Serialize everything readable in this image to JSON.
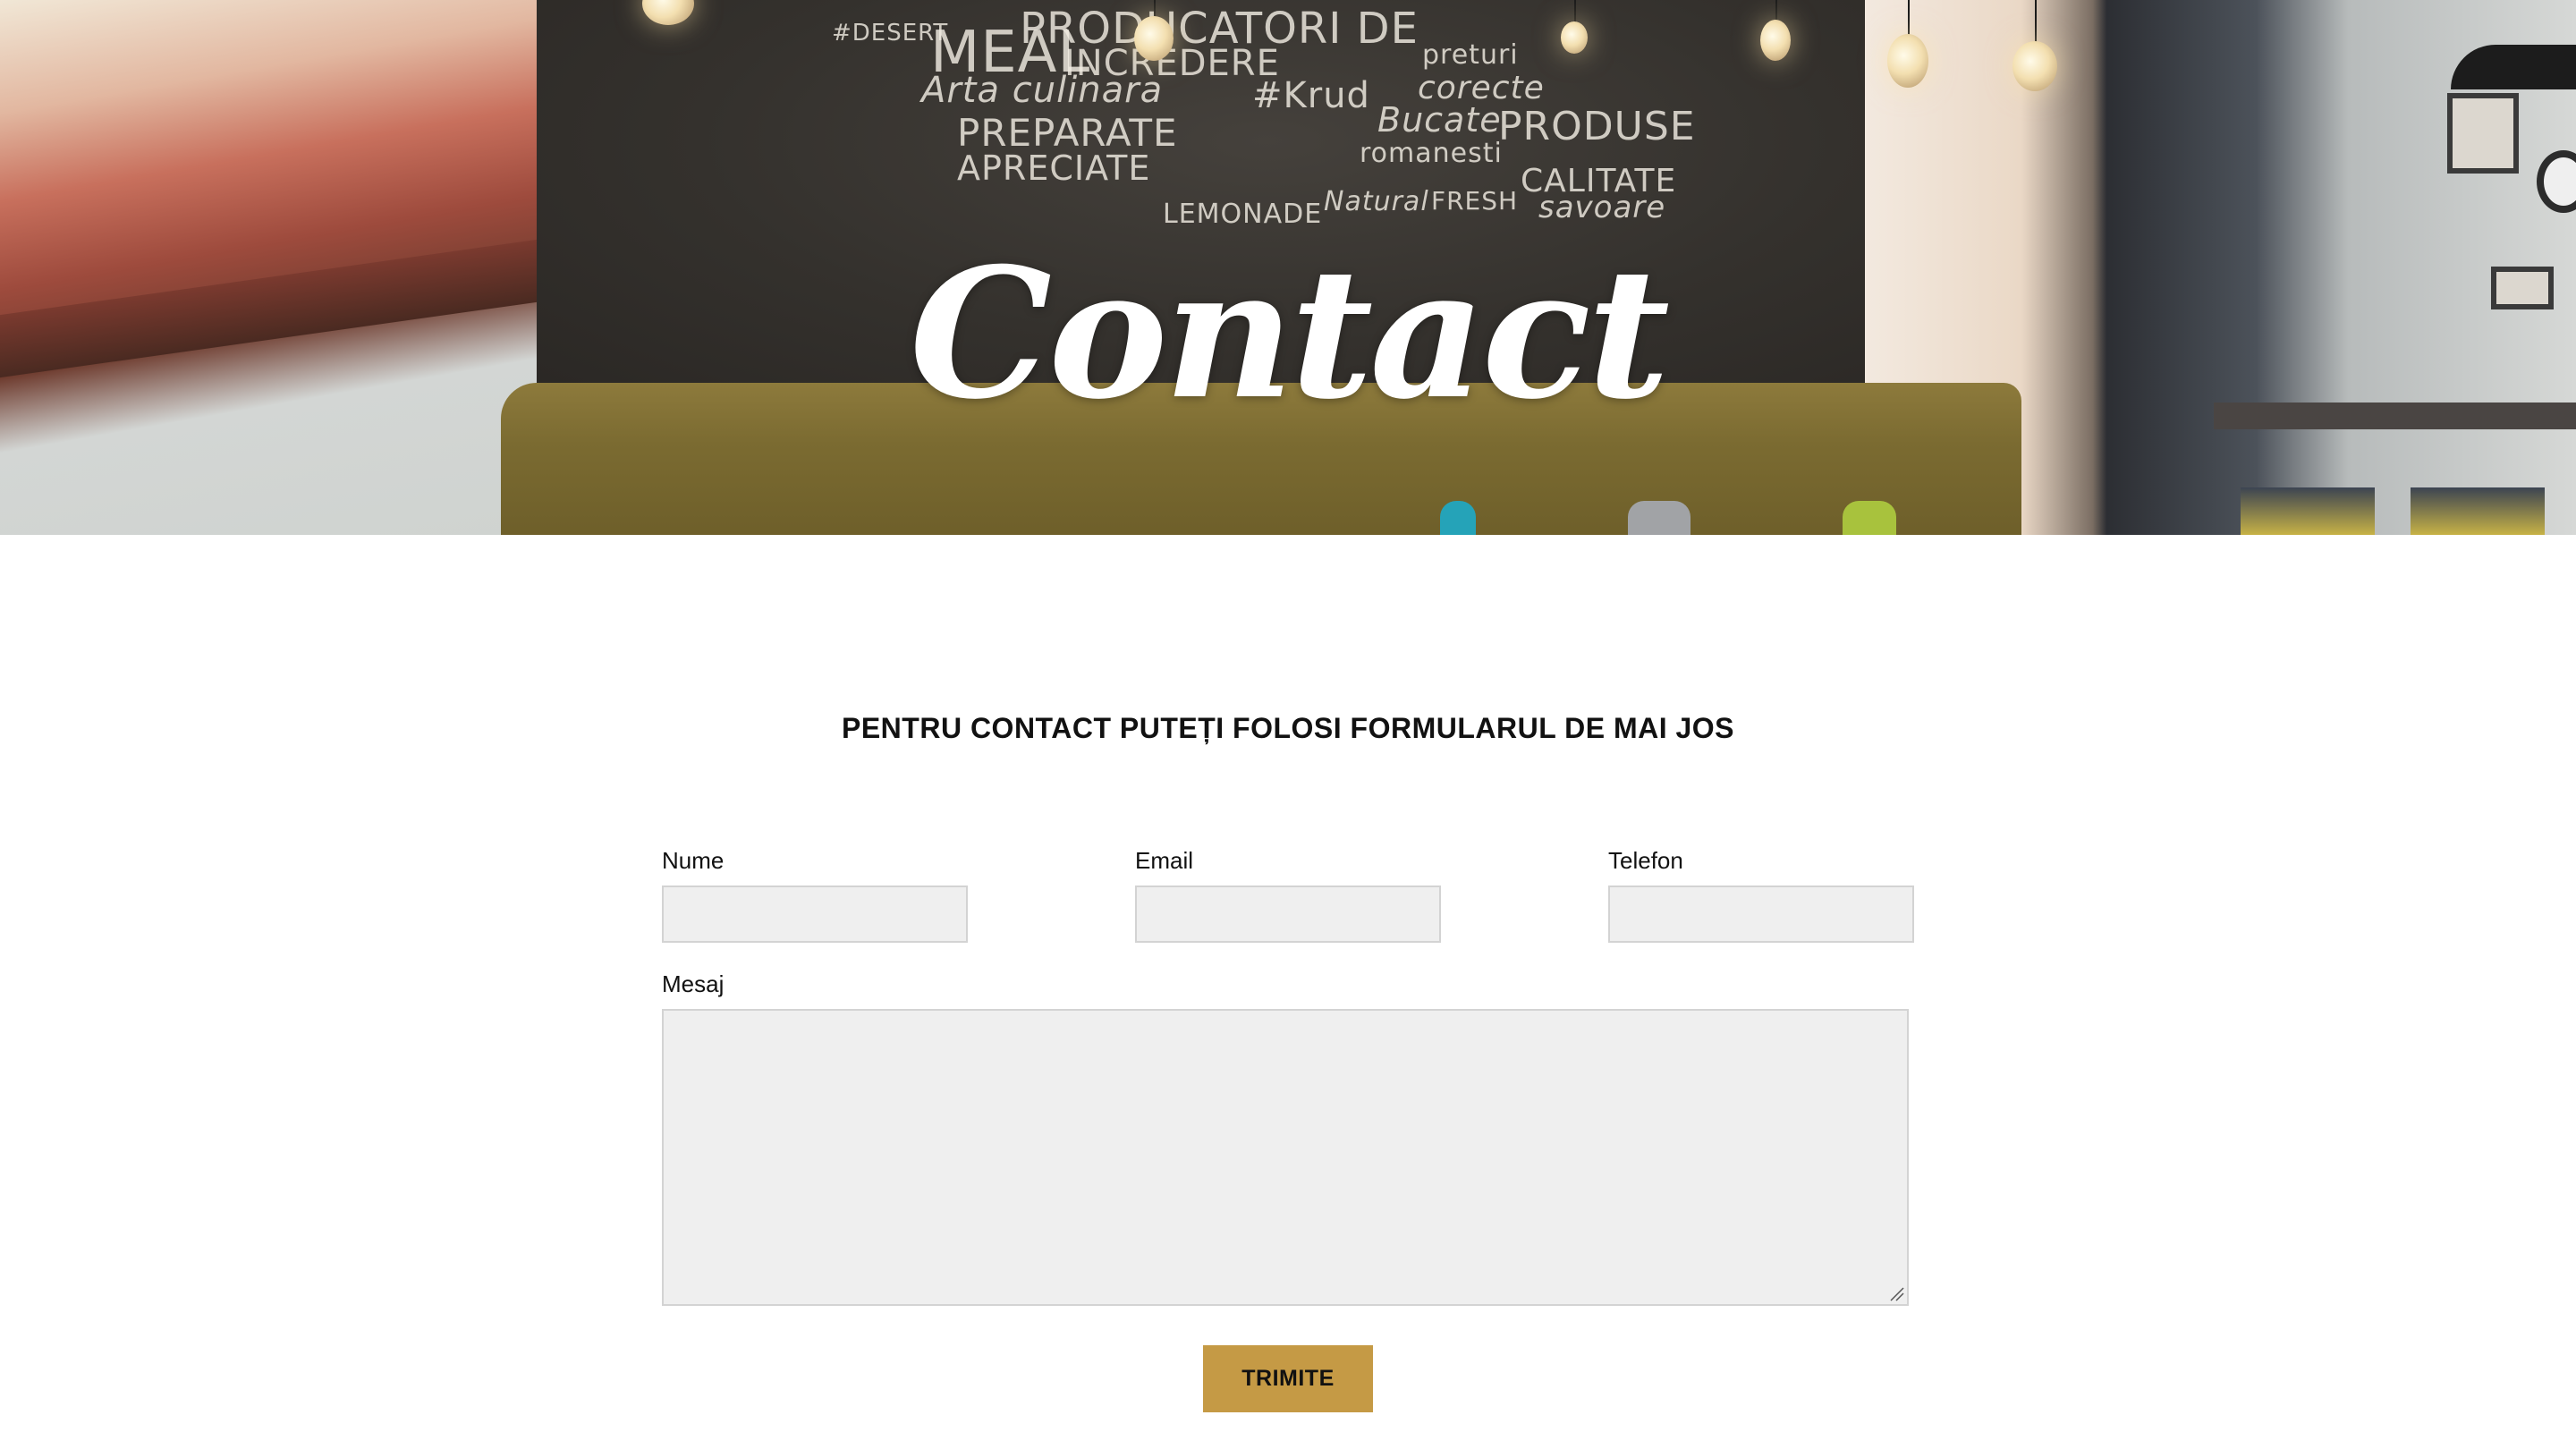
{
  "hero": {
    "title": "Contact",
    "wall_words": [
      "PRODUCATORI DE",
      "MEAL",
      "INCREDERE",
      "Arta culinara",
      "#Krud",
      "PREPARATE",
      "APRECIATE",
      "PRODUSE",
      "CALITATE",
      "LEMONADE",
      "FRESH",
      "corecte",
      "Bucate",
      "savoare",
      "#DESERT",
      "Natural",
      "romanesti",
      "preturi"
    ]
  },
  "contact": {
    "intro": "PENTRU CONTACT PUTEȚI FOLOSI FORMULARUL DE MAI JOS",
    "fields": {
      "name_label": "Nume",
      "email_label": "Email",
      "phone_label": "Telefon",
      "message_label": "Mesaj",
      "name_value": "",
      "email_value": "",
      "phone_value": "",
      "message_value": ""
    },
    "submit_label": "TRIMITE"
  },
  "colors": {
    "accent": "#c59a45",
    "input_bg": "#efefef",
    "input_border": "#d3d3d3",
    "text": "#111111"
  }
}
